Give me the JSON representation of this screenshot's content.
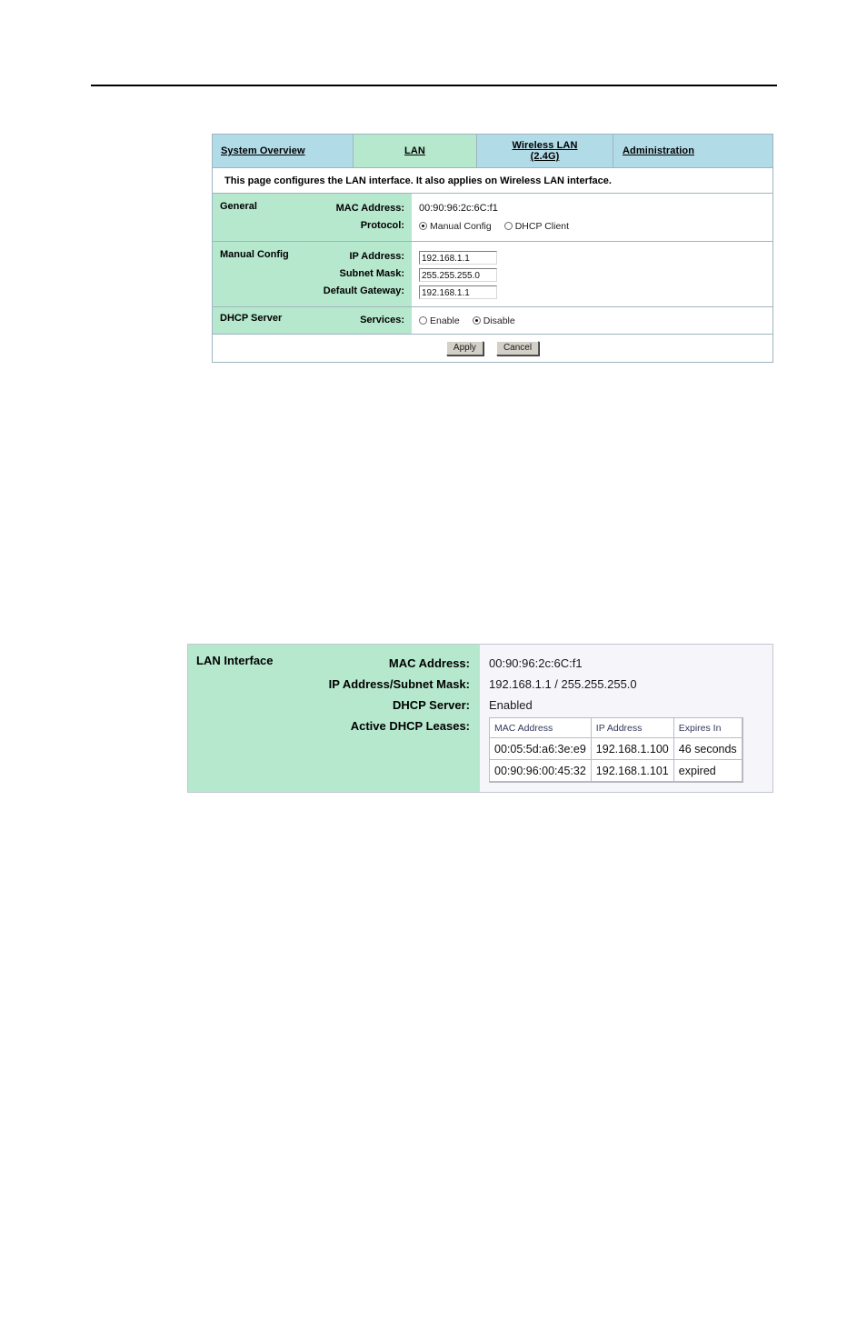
{
  "page": {
    "divider": "horizontal-rule"
  },
  "config_panel": {
    "tabs": [
      {
        "label": "System Overview",
        "state": "inactive"
      },
      {
        "label": "LAN",
        "state": "active"
      },
      {
        "label": "Wireless LAN\n(2.4G)",
        "state": "inactive"
      },
      {
        "label": "Administration",
        "state": "inactive"
      }
    ],
    "description": "This page configures the LAN interface. It also applies on Wireless LAN interface.",
    "general": {
      "section_label": "General",
      "mac_label": "MAC Address:",
      "mac_value": "00:90:96:2c:6C:f1",
      "protocol_label": "Protocol:",
      "protocol_options": [
        {
          "label": "Manual Config",
          "selected": true
        },
        {
          "label": "DHCP Client",
          "selected": false
        }
      ]
    },
    "manual_config": {
      "section_label": "Manual Config",
      "fields": [
        {
          "label": "IP Address:",
          "value": "192.168.1.1"
        },
        {
          "label": "Subnet Mask:",
          "value": "255.255.255.0"
        },
        {
          "label": "Default Gateway:",
          "value": "192.168.1.1"
        }
      ]
    },
    "dhcp_server": {
      "section_label": "DHCP Server",
      "services_label": "Services:",
      "options": [
        {
          "label": "Enable",
          "selected": false
        },
        {
          "label": "Disable",
          "selected": true
        }
      ]
    },
    "buttons": {
      "apply": "Apply",
      "cancel": "Cancel"
    }
  },
  "status_panel": {
    "title": "LAN Interface",
    "rows": [
      {
        "label": "MAC Address:",
        "value": "00:90:96:2c:6C:f1"
      },
      {
        "label": "IP Address/Subnet Mask:",
        "value": "192.168.1.1 / 255.255.255.0"
      },
      {
        "label": "DHCP Server:",
        "value": "Enabled"
      },
      {
        "label": "Active DHCP Leases:",
        "value": ""
      }
    ],
    "leases": {
      "headers": [
        "MAC Address",
        "IP Address",
        "Expires In"
      ],
      "rows": [
        [
          "00:05:5d:a6:3e:e9",
          "192.168.1.100",
          "46 seconds"
        ],
        [
          "00:90:96:00:45:32",
          "192.168.1.101",
          "expired"
        ]
      ]
    }
  },
  "colors": {
    "tab_inactive": "#b2dbe8",
    "tab_active": "#b6e8ce",
    "label_green": "#b6e8ce",
    "panel_border": "#9fb4c0",
    "status_bg": "#f5f5fa"
  }
}
